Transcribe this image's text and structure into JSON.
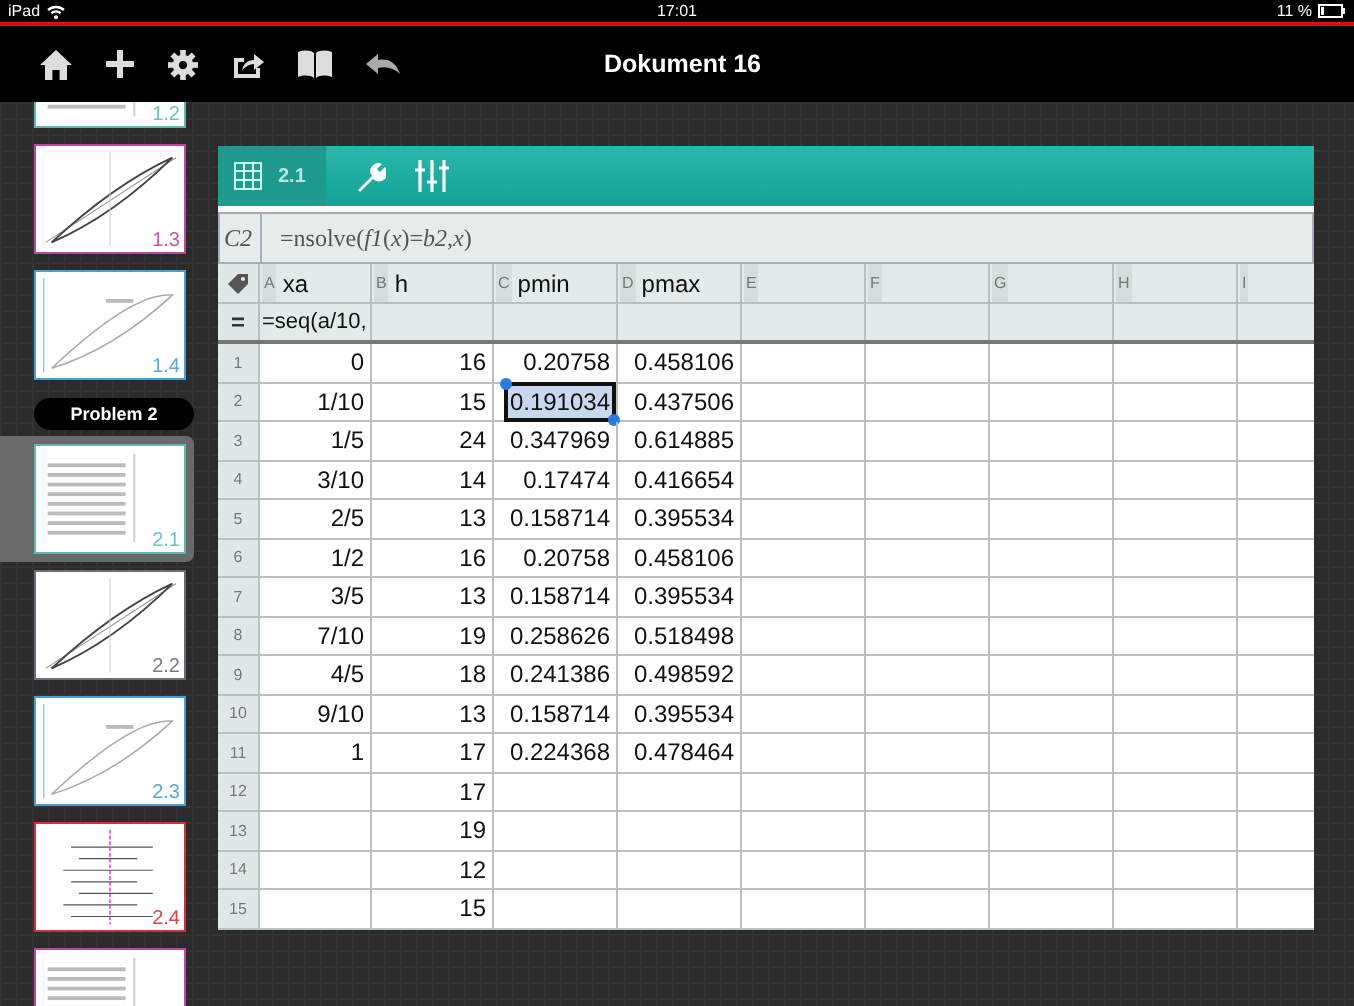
{
  "status_bar": {
    "device": "iPad",
    "time": "17:01",
    "battery": "11 %"
  },
  "toolbar": {
    "title": "Dokument 16"
  },
  "sidebar": {
    "items": [
      {
        "kind": "page",
        "label": "1.2",
        "color": "#5fb8b4",
        "selected": false
      },
      {
        "kind": "page",
        "label": "1.3",
        "color": "#c2469e",
        "selected": false
      },
      {
        "kind": "page",
        "label": "1.4",
        "color": "#4a9ed6",
        "selected": false
      },
      {
        "kind": "problem",
        "label": "Problem 2"
      },
      {
        "kind": "page",
        "label": "2.1",
        "color": "#5fb8b4",
        "selected": true
      },
      {
        "kind": "page",
        "label": "2.2",
        "color": "#6c6c7c",
        "selected": false
      },
      {
        "kind": "page",
        "label": "2.3",
        "color": "#4a9ed6",
        "selected": false
      },
      {
        "kind": "page",
        "label": "2.4",
        "color": "#d2323c",
        "selected": false
      },
      {
        "kind": "page",
        "color": "#c2469e",
        "selected": false
      }
    ]
  },
  "app_header": {
    "page": "2.1"
  },
  "formula_bar": {
    "cell": "C2",
    "formula": "=nsolve(*f1*(*x*)=*b2*,*x*)"
  },
  "columns": [
    {
      "letter": "A",
      "name": "xa"
    },
    {
      "letter": "B",
      "name": "h"
    },
    {
      "letter": "C",
      "name": "pmin"
    },
    {
      "letter": "D",
      "name": "pmax"
    },
    {
      "letter": "E"
    },
    {
      "letter": "F"
    },
    {
      "letter": "G"
    },
    {
      "letter": "H"
    },
    {
      "letter": "I"
    }
  ],
  "formula_row": {
    "symbol": "=",
    "formulas": [
      "=seq(a/10,"
    ]
  },
  "rows": [
    {
      "num": "1",
      "cells": [
        {
          "value": "0",
          "selected": false
        },
        {
          "value": "16",
          "selected": false
        },
        {
          "value": "0.20758",
          "selected": false
        },
        {
          "value": "0.458106",
          "selected": false
        }
      ]
    },
    {
      "num": "2",
      "cells": [
        {
          "value": "1/10",
          "selected": false
        },
        {
          "value": "15",
          "selected": false
        },
        {
          "value": "0.191034",
          "selected": true
        },
        {
          "value": "0.437506",
          "selected": false
        }
      ]
    },
    {
      "num": "3",
      "cells": [
        {
          "value": "1/5",
          "selected": false
        },
        {
          "value": "24",
          "selected": false
        },
        {
          "value": "0.347969",
          "selected": false
        },
        {
          "value": "0.614885",
          "selected": false
        }
      ]
    },
    {
      "num": "4",
      "cells": [
        {
          "value": "3/10",
          "selected": false
        },
        {
          "value": "14",
          "selected": false
        },
        {
          "value": "0.17474",
          "selected": false
        },
        {
          "value": "0.416654",
          "selected": false
        }
      ]
    },
    {
      "num": "5",
      "cells": [
        {
          "value": "2/5",
          "selected": false
        },
        {
          "value": "13",
          "selected": false
        },
        {
          "value": "0.158714",
          "selected": false
        },
        {
          "value": "0.395534",
          "selected": false
        }
      ]
    },
    {
      "num": "6",
      "cells": [
        {
          "value": "1/2",
          "selected": false
        },
        {
          "value": "16",
          "selected": false
        },
        {
          "value": "0.20758",
          "selected": false
        },
        {
          "value": "0.458106",
          "selected": false
        }
      ]
    },
    {
      "num": "7",
      "cells": [
        {
          "value": "3/5",
          "selected": false
        },
        {
          "value": "13",
          "selected": false
        },
        {
          "value": "0.158714",
          "selected": false
        },
        {
          "value": "0.395534",
          "selected": false
        }
      ]
    },
    {
      "num": "8",
      "cells": [
        {
          "value": "7/10",
          "selected": false
        },
        {
          "value": "19",
          "selected": false
        },
        {
          "value": "0.258626",
          "selected": false
        },
        {
          "value": "0.518498",
          "selected": false
        }
      ]
    },
    {
      "num": "9",
      "cells": [
        {
          "value": "4/5",
          "selected": false
        },
        {
          "value": "18",
          "selected": false
        },
        {
          "value": "0.241386",
          "selected": false
        },
        {
          "value": "0.498592",
          "selected": false
        }
      ]
    },
    {
      "num": "10",
      "cells": [
        {
          "value": "9/10",
          "selected": false
        },
        {
          "value": "13",
          "selected": false
        },
        {
          "value": "0.158714",
          "selected": false
        },
        {
          "value": "0.395534",
          "selected": false
        }
      ]
    },
    {
      "num": "11",
      "cells": [
        {
          "value": "1",
          "selected": false
        },
        {
          "value": "17",
          "selected": false
        },
        {
          "value": "0.224368",
          "selected": false
        },
        {
          "value": "0.478464",
          "selected": false
        }
      ]
    },
    {
      "num": "12",
      "cells": [
        null,
        {
          "value": "17",
          "selected": false
        }
      ]
    },
    {
      "num": "13",
      "cells": [
        null,
        {
          "value": "19",
          "selected": false
        }
      ]
    },
    {
      "num": "14",
      "cells": [
        null,
        {
          "value": "12",
          "selected": false
        }
      ]
    },
    {
      "num": "15",
      "cells": [
        null,
        {
          "value": "15",
          "selected": false
        }
      ]
    }
  ]
}
